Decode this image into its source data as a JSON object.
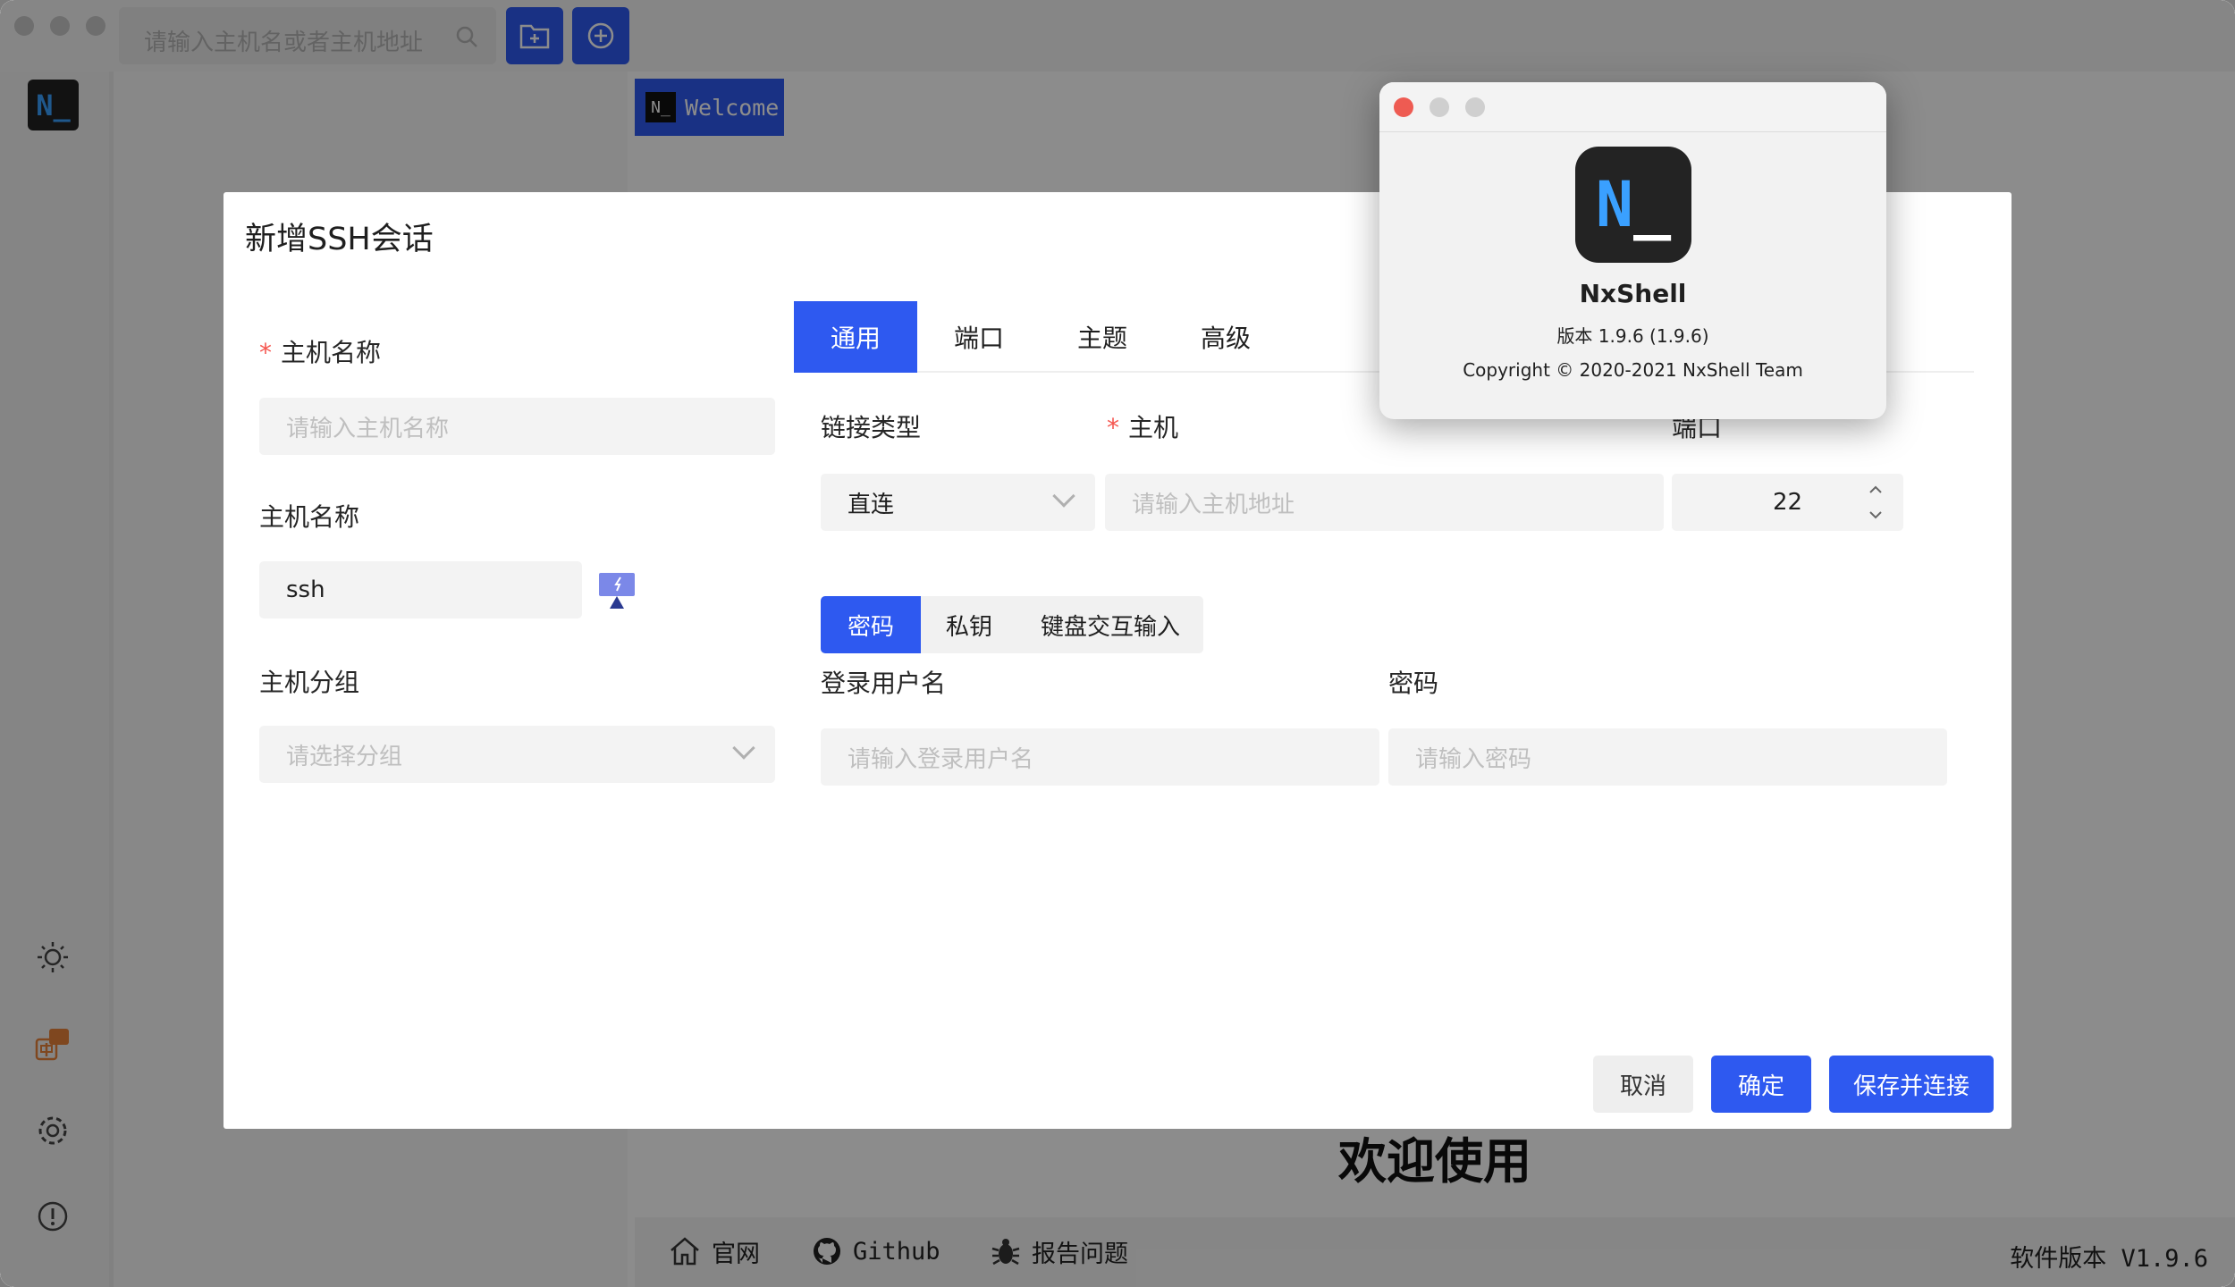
{
  "app": {
    "search_placeholder": "请输入主机名或者主机地址",
    "logo_text": "N_",
    "welcome_tab": "Welcome",
    "welcome_heading": "欢迎使用",
    "footer": {
      "website": "官网",
      "github": "Github",
      "report": "报告问题",
      "version": "软件版本 V1.9.6"
    }
  },
  "dialog": {
    "title": "新增SSH会话",
    "left": {
      "host_name_label": "主机名称",
      "host_name_placeholder": "请输入主机名称",
      "host_name2_label": "主机名称",
      "host_name2_value": "ssh",
      "group_label": "主机分组",
      "group_placeholder": "请选择分组"
    },
    "tabs": [
      "通用",
      "端口",
      "主题",
      "高级"
    ],
    "active_tab": "通用",
    "general": {
      "link_type_label": "链接类型",
      "link_type_value": "直连",
      "host_label": "主机",
      "host_placeholder": "请输入主机地址",
      "port_label": "端口",
      "port_value": "22",
      "auth_options": [
        "密码",
        "私钥",
        "键盘交互输入"
      ],
      "auth_active": "密码",
      "username_label": "登录用户名",
      "username_placeholder": "请输入登录用户名",
      "password_label": "密码",
      "password_placeholder": "请输入密码"
    },
    "buttons": {
      "cancel": "取消",
      "ok": "确定",
      "save_connect": "保存并连接"
    }
  },
  "about": {
    "logo_n": "N",
    "logo_cursor": "_",
    "name": "NxShell",
    "version": "版本 1.9.6 (1.9.6)",
    "copyright": "Copyright © 2020-2021 NxShell Team"
  },
  "colors": {
    "accent": "#2e59f0",
    "required": "#f5564f",
    "close_red": "#ee5b52"
  }
}
